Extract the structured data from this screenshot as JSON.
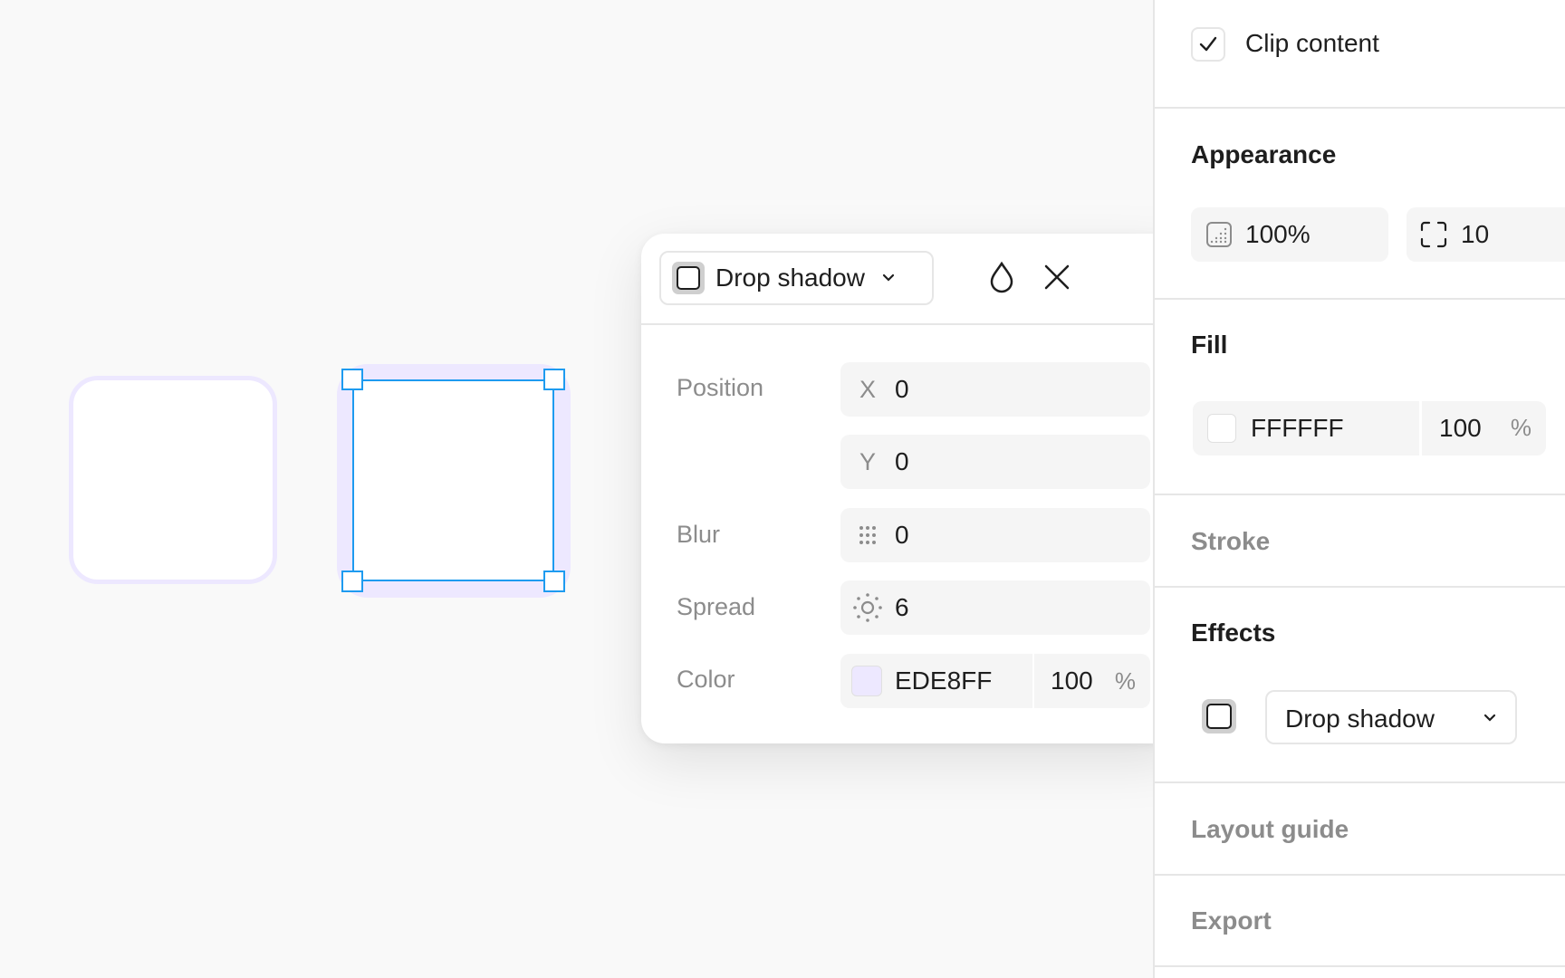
{
  "popover": {
    "effect_type": "Drop shadow",
    "position_label": "Position",
    "x_prefix": "X",
    "x_value": "0",
    "y_prefix": "Y",
    "y_value": "0",
    "blur_label": "Blur",
    "blur_value": "0",
    "spread_label": "Spread",
    "spread_value": "6",
    "color_label": "Color",
    "color_hex": "EDE8FF",
    "color_opacity": "100",
    "percent_sign": "%",
    "icons": [
      "dropdown-chevron-icon",
      "opacity-drop-icon",
      "close-icon",
      "blur-dots-icon",
      "spread-sun-icon"
    ]
  },
  "panel": {
    "clip_content_label": "Clip content",
    "clip_content_checked": true,
    "appearance_title": "Appearance",
    "opacity_value": "100%",
    "radius_value": "10",
    "fill_title": "Fill",
    "fill_hex": "FFFFFF",
    "fill_opacity": "100",
    "percent_sign": "%",
    "stroke_title": "Stroke",
    "effects_title": "Effects",
    "effect_type": "Drop shadow",
    "layout_guide_title": "Layout guide",
    "export_title": "Export"
  },
  "colors": {
    "selection": "#1e9bf0",
    "shadow_color": "#ede8ff",
    "fill_color": "#ffffff"
  }
}
